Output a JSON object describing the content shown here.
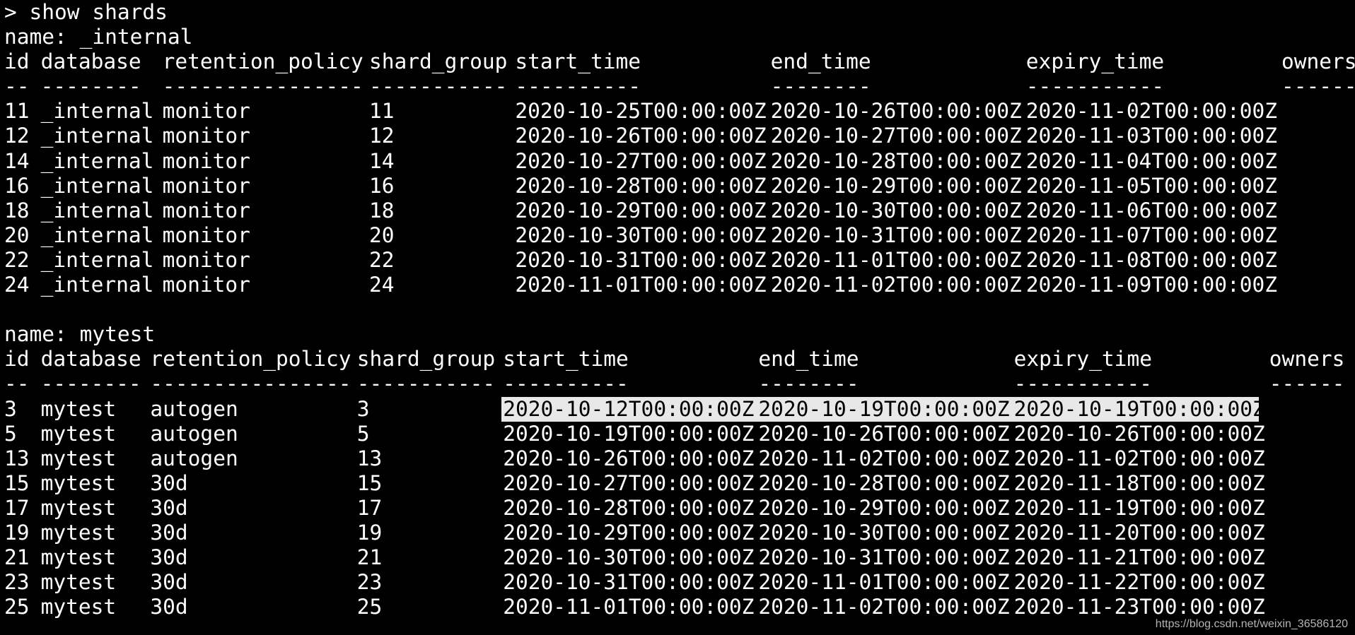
{
  "terminal": {
    "command": "> show shards",
    "watermark": "https://blog.csdn.net/weixin_36586120",
    "highlight_color": "#e8e8e8",
    "background_color": "#000000",
    "text_color": "#ffffff"
  },
  "tables": [
    {
      "name_line": "name: _internal",
      "columns": [
        "id",
        "database",
        "retention_policy",
        "shard_group",
        "start_time",
        "end_time",
        "expiry_time",
        "owners"
      ],
      "separators": [
        "--",
        "--------",
        "----------------",
        "-----------",
        "----------",
        "--------",
        "-----------",
        "------"
      ],
      "rows": [
        [
          "11",
          "_internal",
          "monitor",
          "11",
          "2020-10-25T00:00:00Z",
          "2020-10-26T00:00:00Z",
          "2020-11-02T00:00:00Z",
          ""
        ],
        [
          "12",
          "_internal",
          "monitor",
          "12",
          "2020-10-26T00:00:00Z",
          "2020-10-27T00:00:00Z",
          "2020-11-03T00:00:00Z",
          ""
        ],
        [
          "14",
          "_internal",
          "monitor",
          "14",
          "2020-10-27T00:00:00Z",
          "2020-10-28T00:00:00Z",
          "2020-11-04T00:00:00Z",
          ""
        ],
        [
          "16",
          "_internal",
          "monitor",
          "16",
          "2020-10-28T00:00:00Z",
          "2020-10-29T00:00:00Z",
          "2020-11-05T00:00:00Z",
          ""
        ],
        [
          "18",
          "_internal",
          "monitor",
          "18",
          "2020-10-29T00:00:00Z",
          "2020-10-30T00:00:00Z",
          "2020-11-06T00:00:00Z",
          ""
        ],
        [
          "20",
          "_internal",
          "monitor",
          "20",
          "2020-10-30T00:00:00Z",
          "2020-10-31T00:00:00Z",
          "2020-11-07T00:00:00Z",
          ""
        ],
        [
          "22",
          "_internal",
          "monitor",
          "22",
          "2020-10-31T00:00:00Z",
          "2020-11-01T00:00:00Z",
          "2020-11-08T00:00:00Z",
          ""
        ],
        [
          "24",
          "_internal",
          "monitor",
          "24",
          "2020-11-01T00:00:00Z",
          "2020-11-02T00:00:00Z",
          "2020-11-09T00:00:00Z",
          ""
        ]
      ]
    },
    {
      "name_line": "name: mytest",
      "columns": [
        "id",
        "database",
        "retention_policy",
        "shard_group",
        "start_time",
        "end_time",
        "expiry_time",
        "owners"
      ],
      "separators": [
        "--",
        "--------",
        "----------------",
        "-----------",
        "----------",
        "--------",
        "-----------",
        "------"
      ],
      "rows": [
        [
          "3",
          "mytest",
          "autogen",
          "3",
          "2020-10-12T00:00:00Z",
          "2020-10-19T00:00:00Z",
          "2020-10-19T00:00:00Z",
          ""
        ],
        [
          "5",
          "mytest",
          "autogen",
          "5",
          "2020-10-19T00:00:00Z",
          "2020-10-26T00:00:00Z",
          "2020-10-26T00:00:00Z",
          ""
        ],
        [
          "13",
          "mytest",
          "autogen",
          "13",
          "2020-10-26T00:00:00Z",
          "2020-11-02T00:00:00Z",
          "2020-11-02T00:00:00Z",
          ""
        ],
        [
          "15",
          "mytest",
          "30d",
          "15",
          "2020-10-27T00:00:00Z",
          "2020-10-28T00:00:00Z",
          "2020-11-18T00:00:00Z",
          ""
        ],
        [
          "17",
          "mytest",
          "30d",
          "17",
          "2020-10-28T00:00:00Z",
          "2020-10-29T00:00:00Z",
          "2020-11-19T00:00:00Z",
          ""
        ],
        [
          "19",
          "mytest",
          "30d",
          "19",
          "2020-10-29T00:00:00Z",
          "2020-10-30T00:00:00Z",
          "2020-11-20T00:00:00Z",
          ""
        ],
        [
          "21",
          "mytest",
          "30d",
          "21",
          "2020-10-30T00:00:00Z",
          "2020-10-31T00:00:00Z",
          "2020-11-21T00:00:00Z",
          ""
        ],
        [
          "23",
          "mytest",
          "30d",
          "23",
          "2020-10-31T00:00:00Z",
          "2020-11-01T00:00:00Z",
          "2020-11-22T00:00:00Z",
          ""
        ],
        [
          "25",
          "mytest",
          "30d",
          "25",
          "2020-11-01T00:00:00Z",
          "2020-11-02T00:00:00Z",
          "2020-11-23T00:00:00Z",
          ""
        ]
      ]
    }
  ]
}
